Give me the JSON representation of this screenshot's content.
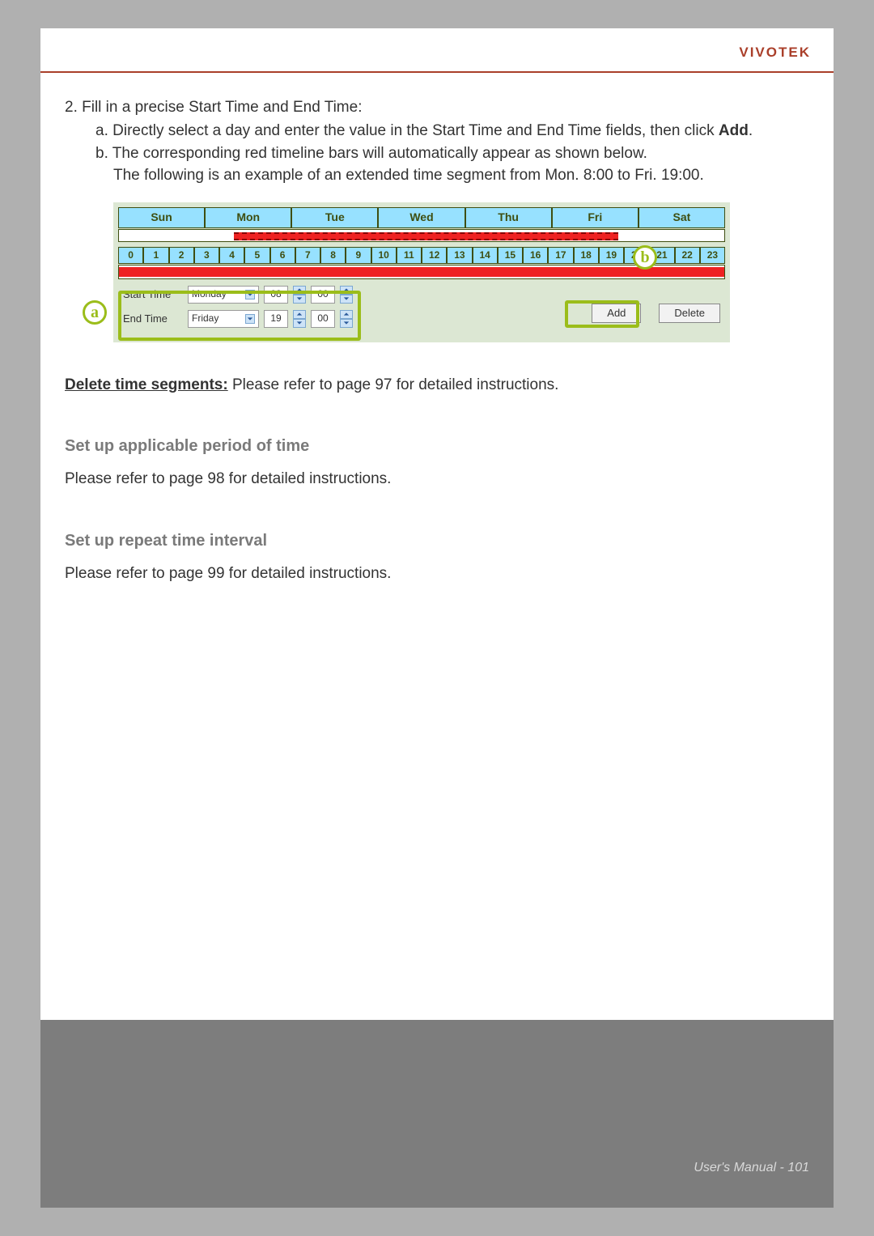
{
  "brand": "VIVOTEK",
  "step2_intro": "2. Fill in a precise Start Time and End Time:",
  "step2a_prefix": "a. Directly select a day and enter the value in the Start Time and End Time fields, then click ",
  "step2a_bold": "Add",
  "step2a_suffix": ".",
  "step2b_line1": "b. The corresponding red timeline bars will automatically appear as shown below.",
  "step2b_line2": "The following is an example of an extended time segment from Mon. 8:00 to Fri. 19:00.",
  "days": [
    "Sun",
    "Mon",
    "Tue",
    "Wed",
    "Thu",
    "Fri",
    "Sat"
  ],
  "hours": [
    "0",
    "1",
    "2",
    "3",
    "4",
    "5",
    "6",
    "7",
    "8",
    "9",
    "10",
    "11",
    "12",
    "13",
    "14",
    "15",
    "16",
    "17",
    "18",
    "19",
    "20",
    "21",
    "22",
    "23"
  ],
  "start_label": "Start Time",
  "end_label": "End Time",
  "start_day": "Monday",
  "end_day": "Friday",
  "start_hour": "08",
  "start_min": "00",
  "end_hour": "19",
  "end_min": "00",
  "add_btn": "Add",
  "delete_btn": "Delete",
  "badge_a": "a",
  "badge_b": "b",
  "delete_seg_heading": "Delete time segments:",
  "delete_seg_text": "  Please refer to page 97 for detailed instructions.",
  "sec1_heading": "Set up applicable period of time",
  "sec1_body": "Please refer to page 98 for detailed instructions.",
  "sec2_heading": "Set up repeat time interval",
  "sec2_body": "Please refer to page 99 for detailed instructions.",
  "footer_label": "User's Manual - ",
  "footer_page": "101"
}
